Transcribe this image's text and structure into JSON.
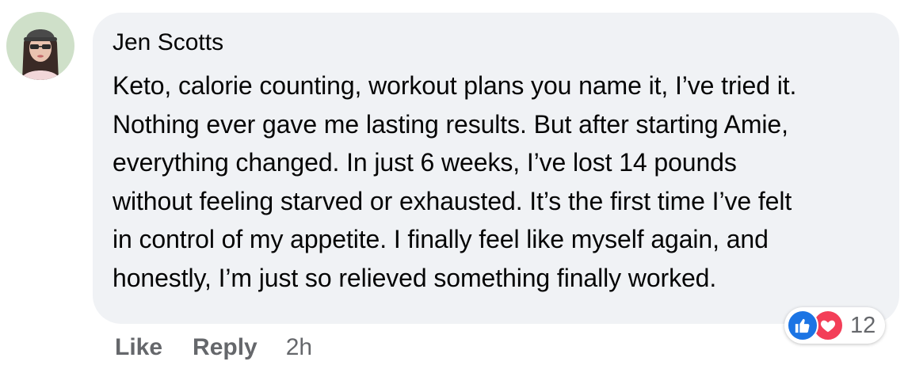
{
  "comment": {
    "author": "Jen Scotts",
    "text": "Keto, calorie counting, workout plans you name it, I’ve tried it.\nNothing ever gave me lasting results. But after starting Amie,\neverything changed. In just 6 weeks, I’ve lost 14 pounds\nwithout feeling starved or exhausted. It’s the first time I’ve felt\nin control of my appetite. I finally feel like myself again, and\nhonestly, I’m just so relieved something finally worked.",
    "avatar_icon": "profile-photo",
    "reactions": {
      "icons": [
        "like-icon",
        "love-icon"
      ],
      "count": "12",
      "like_color": "#1b74e4",
      "love_color": "#f33e58"
    },
    "actions": {
      "like_label": "Like",
      "reply_label": "Reply",
      "timestamp": "2h"
    }
  },
  "colors": {
    "bubble_bg": "#f0f2f5",
    "text": "#050505",
    "secondary_text": "#65676b"
  }
}
